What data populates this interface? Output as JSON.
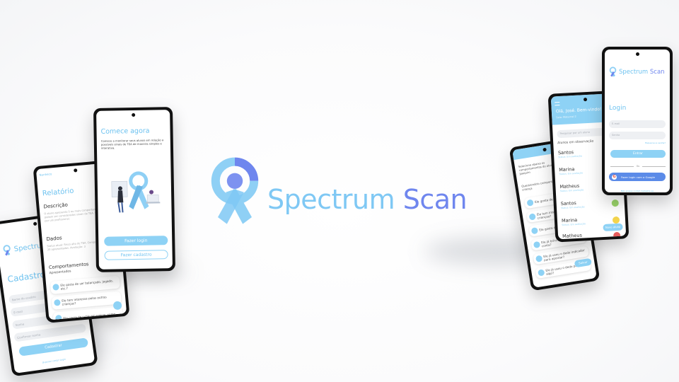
{
  "brand": {
    "name_part1": "Spectrum",
    "name_part2": "Scan",
    "color_light": "#7fc8f4",
    "color_dark": "#6f86ee"
  },
  "phone_start": {
    "title": "Comece agora",
    "description": "Comece a monitorar seus alunos em relação a possíveis sinais de TEA de maneira simples e interativa.",
    "login_button": "Fazer login",
    "signup_button": "Fazer cadastro"
  },
  "phone_report": {
    "top_label": "Nunheco",
    "title": "Relatório",
    "section_description": "Descrição",
    "description_text": "O aluno apresenta 5 ou mais comportamentos que podem ser considerados sinais de TEA. Deve ser visto por um profissional.",
    "section_data": "Dados",
    "data_text": "Status atual: Risco alto de TEA. Comportamentos: 8 de 20 apresentados. Avaliação: 3",
    "section_behaviors": "Comportamentos",
    "behaviors_sub": "Apresentados",
    "items": [
      "Ele gosta de ser balançado, jogado, etc.?",
      "Ele tem interesse pelas outras crianças?",
      "Ele gosta de subir em coisas, como..."
    ]
  },
  "phone_signup": {
    "logo_part1": "Spectrum",
    "logo_part2": "Sc",
    "title": "Cadastro",
    "field_1": "Nome do usuário",
    "field_2": "E-mail",
    "field_3": "Senha",
    "field_4": "Confirmar senha",
    "button": "Cadastrar",
    "footer": "Já possui conta? Login"
  },
  "phone_login": {
    "logo_part1": "Spectrum",
    "logo_part2": "Scan",
    "title": "Login",
    "email_placeholder": "E-mail",
    "password_placeholder": "Senha",
    "forgot": "Esqueceu a senha?",
    "enter_button": "Entrar",
    "or": "Ou",
    "google_button": "Fazer login com o Google",
    "footer": "Não possui conta? Cadastre-se"
  },
  "phone_students": {
    "header": "Olá, José. Bem-vindo!",
    "header_sub": "Sala: Maternal 2",
    "search_placeholder": "Pesquisar por um aluno",
    "section": "Alunos em observação",
    "students": [
      {
        "name": "Santos",
        "sub": "Status: Em avaliação",
        "color": "#9bd56b"
      },
      {
        "name": "Marina",
        "sub": "Status: Em avaliação",
        "color": "#9bd56b"
      },
      {
        "name": "Matheus",
        "sub": "Status: Em avaliação",
        "color": "#f3d44c"
      },
      {
        "name": "Santos",
        "sub": "Status: Em avaliação",
        "color": "#9bd56b"
      },
      {
        "name": "Marina",
        "sub": "Status: Em avaliação",
        "color": "#f3d44c"
      },
      {
        "name": "Matheus",
        "sub": "Status: Em avaliação",
        "color": "#e65c5c"
      }
    ],
    "add_button": "Novo aluno"
  },
  "phone_questions": {
    "header": "Selecione abaixo os comportamentos do aluno Joaquim",
    "questions_title": "Questionário comportamental da criança",
    "items": [
      "Ele gosta de ser balançado?",
      "Ele tem interesse pelas outras crianças?",
      "Ele gosta de subir em coisas?",
      "Ele já brincou de faz-de-conta?",
      "Ele já usou o dedo indicador para apontar?",
      "Ele já usou o dedo para pedir algo?"
    ],
    "save_button": "Salvar"
  }
}
